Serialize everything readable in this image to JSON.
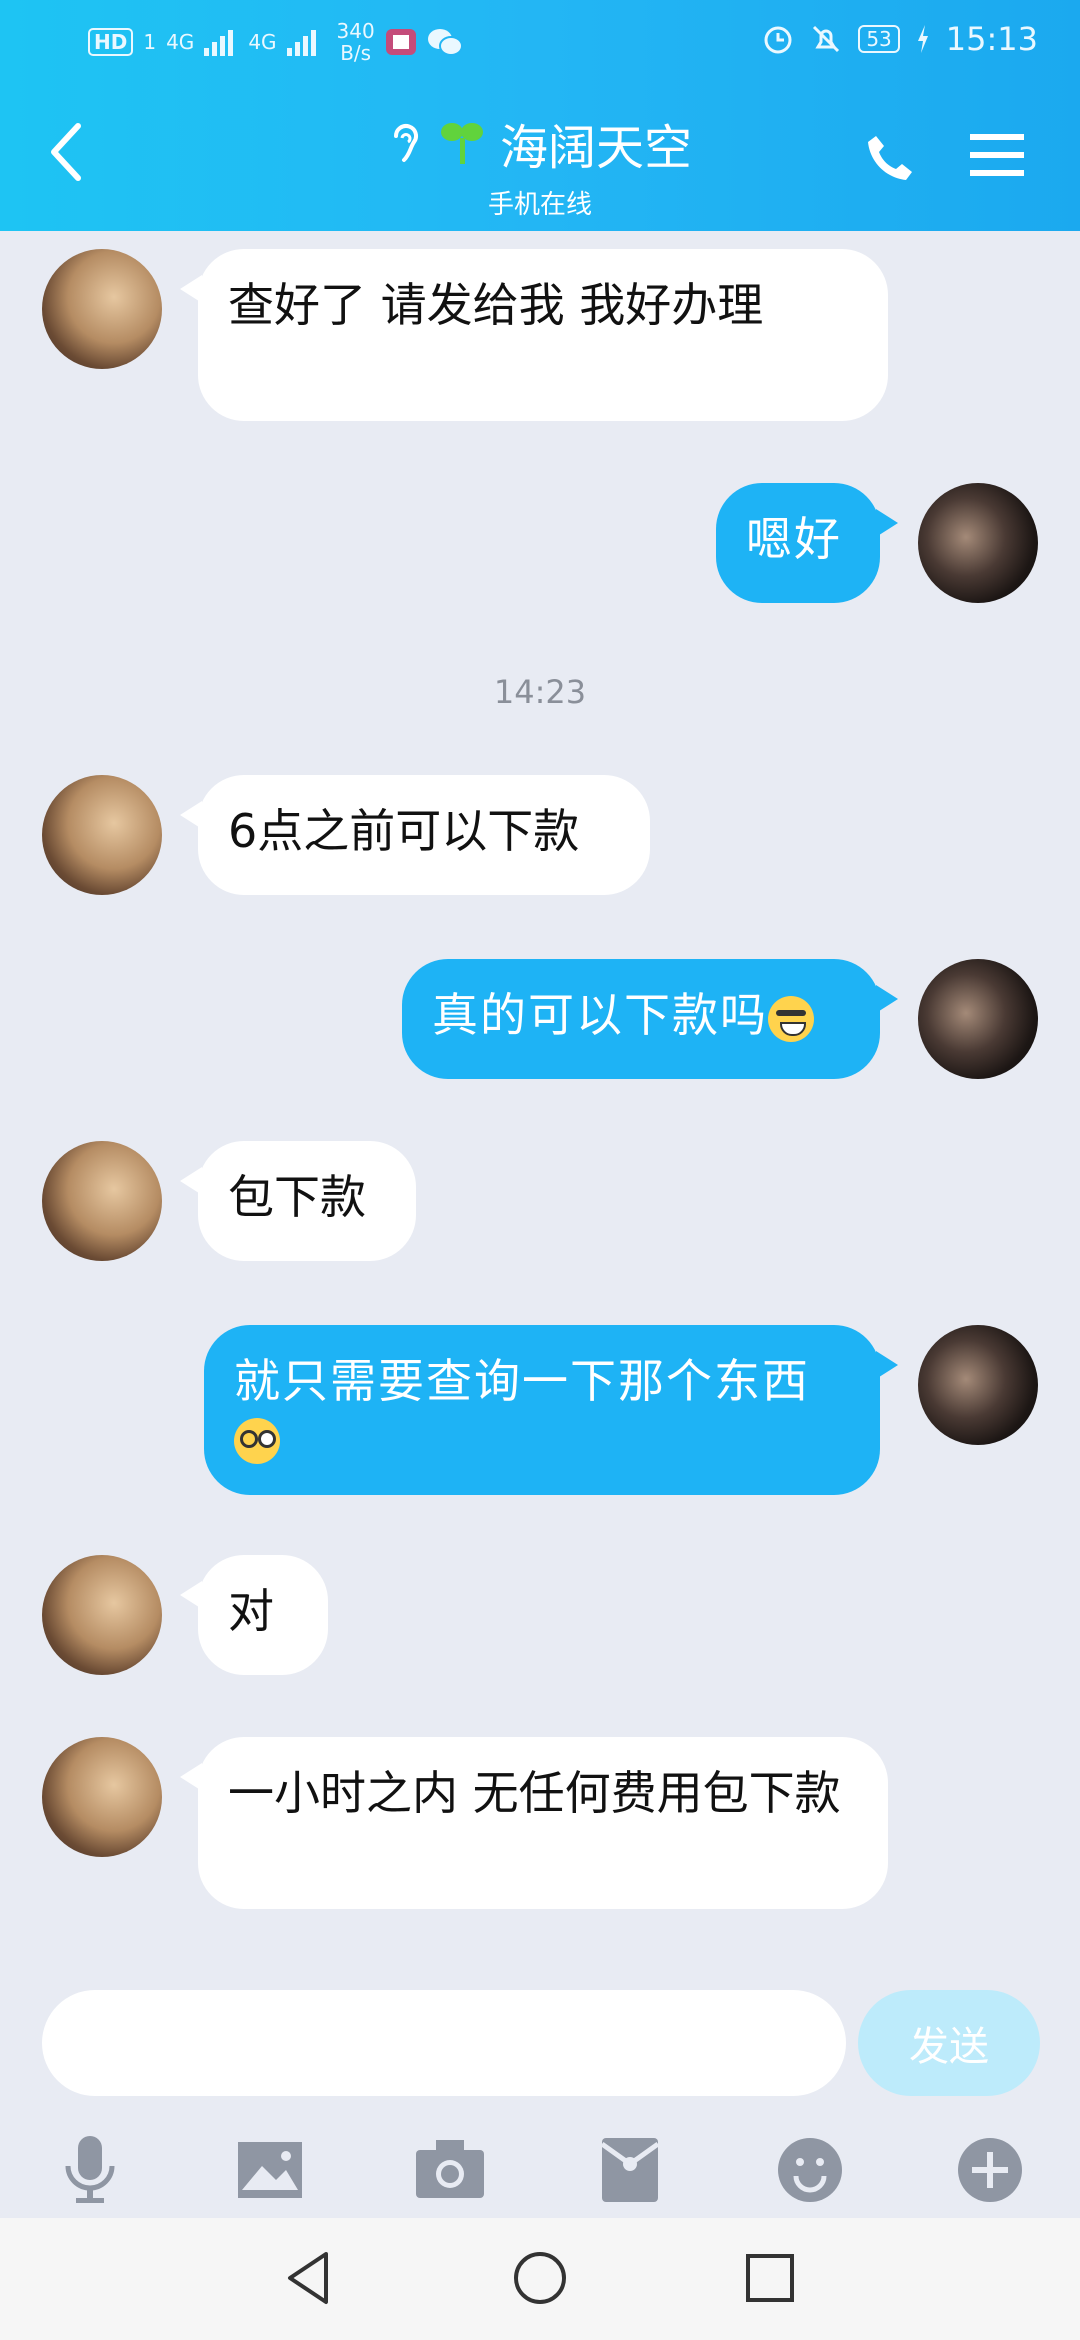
{
  "status_bar": {
    "hd": "HD",
    "sim1": "1",
    "net1": "4G",
    "net2": "4G",
    "speed_value": "340",
    "speed_unit": "B/s",
    "battery": "53",
    "time": "15:13"
  },
  "header": {
    "title": "海阔天空",
    "subtitle": "手机在线"
  },
  "messages": [
    {
      "side": "in",
      "text": "查好了   请发给我  我好办理"
    },
    {
      "side": "out",
      "text": "嗯好"
    },
    {
      "side": "time",
      "text": "14:23"
    },
    {
      "side": "in",
      "text": "6点之前可以下款"
    },
    {
      "side": "out",
      "text": "真的可以下款吗",
      "emoji": "tears-of-joy-emoji"
    },
    {
      "side": "in",
      "text": "包下款"
    },
    {
      "side": "out",
      "text": "就只需要查询一下那个东西",
      "emoji": "dizzy-face-emoji"
    },
    {
      "side": "in",
      "text": "对"
    },
    {
      "side": "in",
      "text": "一小时之内  无任何费用包下款"
    }
  ],
  "composer": {
    "value": "",
    "placeholder": "",
    "send_label": "发送"
  },
  "colors": {
    "header_start": "#1ec4f3",
    "header_end": "#1ba9ef",
    "outgoing_bubble": "#1eb3f5",
    "chat_background": "#e8ebf3"
  }
}
